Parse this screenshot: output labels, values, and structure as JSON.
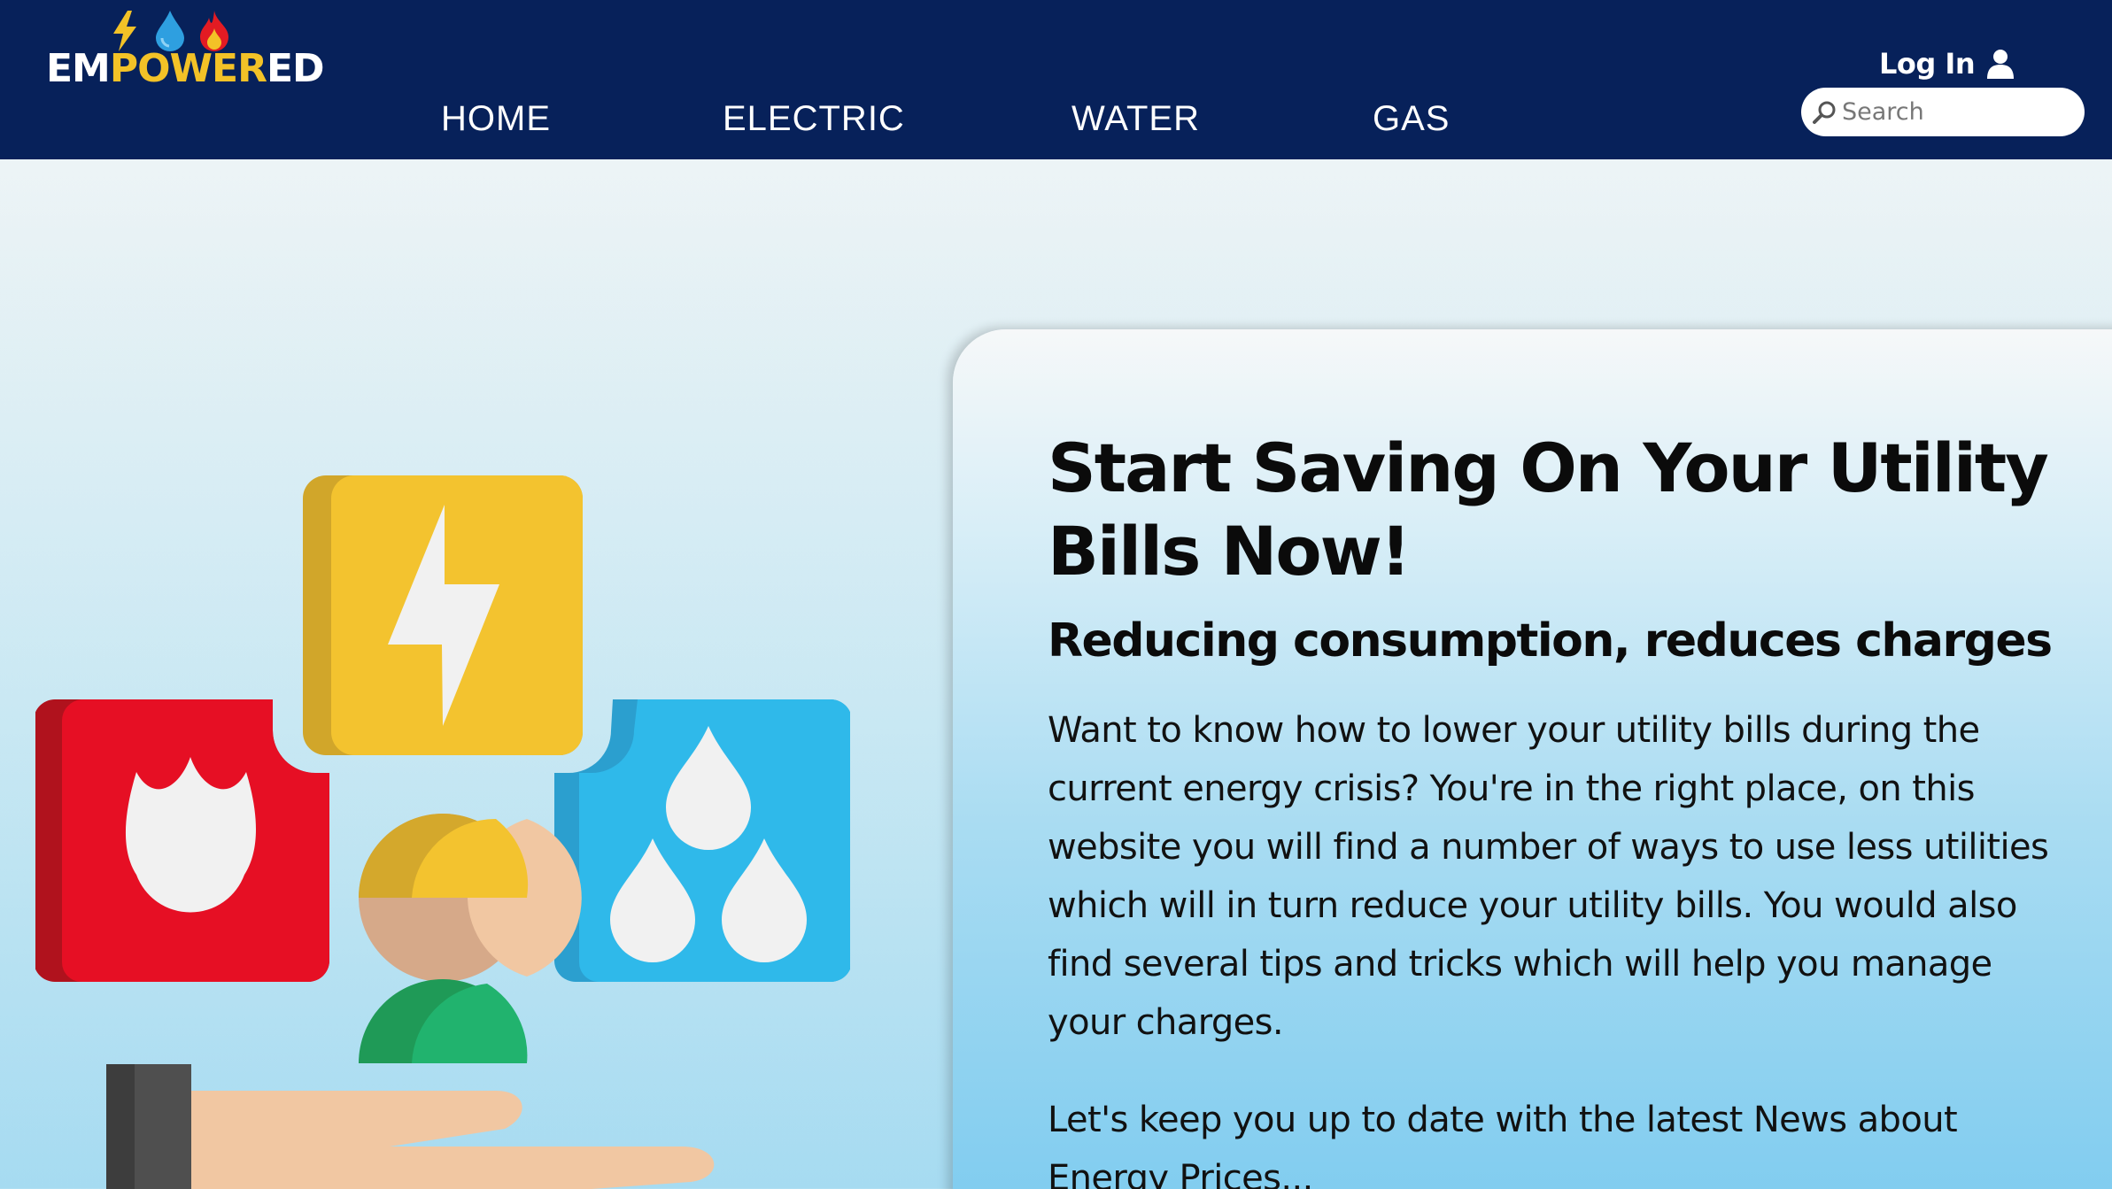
{
  "brand": {
    "logo_text_white_1": "EM",
    "logo_text_yellow": "POWER",
    "logo_text_white_2": "ED",
    "icons": [
      "lightning-icon",
      "water-drop-icon",
      "flame-icon"
    ],
    "colors": {
      "navy": "#07215a",
      "yellow": "#f3c227",
      "blue": "#2e9fe0",
      "red": "#e31b23"
    }
  },
  "nav": {
    "items": [
      {
        "label": "HOME"
      },
      {
        "label": "ELECTRIC"
      },
      {
        "label": "WATER"
      },
      {
        "label": "GAS"
      }
    ]
  },
  "header": {
    "login_label": "Log In",
    "search_placeholder": "Search"
  },
  "hero": {
    "title": "Start Saving On Your Utility Bills Now!",
    "subtitle": "Reducing consumption, reduces charges",
    "body": "Want to know how to lower your utility bills during the current energy crisis? You're in the right place, on this website you will find a number of ways to use less utilities which will in turn reduce your utility bills. You would also find several tips and tricks which will help you manage your charges.",
    "body2": "Let's keep you up to date with the latest News about Energy Prices..."
  }
}
